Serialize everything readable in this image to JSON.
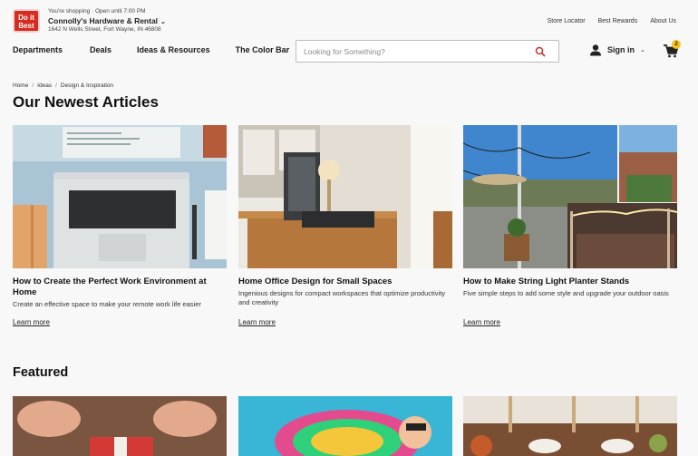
{
  "header": {
    "logo_line1": "Do it",
    "logo_line2": "Best",
    "shopping_line": "You're shopping  ·  Open until 7:00 PM",
    "store_name": "Connolly's Hardware & Rental",
    "store_address": "1642 N Wells Street, Fort Wayne, IN 46808",
    "util_links": [
      "Store Locator",
      "Best Rewards",
      "About Us"
    ]
  },
  "nav": {
    "items": [
      "Departments",
      "Deals",
      "Ideas & Resources",
      "The Color Bar"
    ],
    "search_placeholder": "Looking for Something?",
    "signin_label": "Sign in",
    "cart_count": "2"
  },
  "breadcrumb": [
    "Home",
    "Ideas",
    "Design & Inspiration"
  ],
  "page_title": "Our Newest Articles",
  "articles": [
    {
      "title": "How to Create the Perfect Work Environment at Home",
      "desc": "Create an effective space to make your remote work life easier",
      "link": "Learn more"
    },
    {
      "title": "Home Office Design for Small Spaces",
      "desc": "Ingenious designs for compact workspaces that optimize productivity and creativity",
      "link": "Learn more"
    },
    {
      "title": "How to Make String Light Planter Stands",
      "desc": "Five simple steps to add some style and upgrade your outdoor oasis",
      "link": "Learn more"
    }
  ],
  "featured_title": "Featured",
  "colors": {
    "brand_red": "#d62b1f",
    "badge_yellow": "#f7c11a",
    "search_icon": "#c8322a"
  }
}
